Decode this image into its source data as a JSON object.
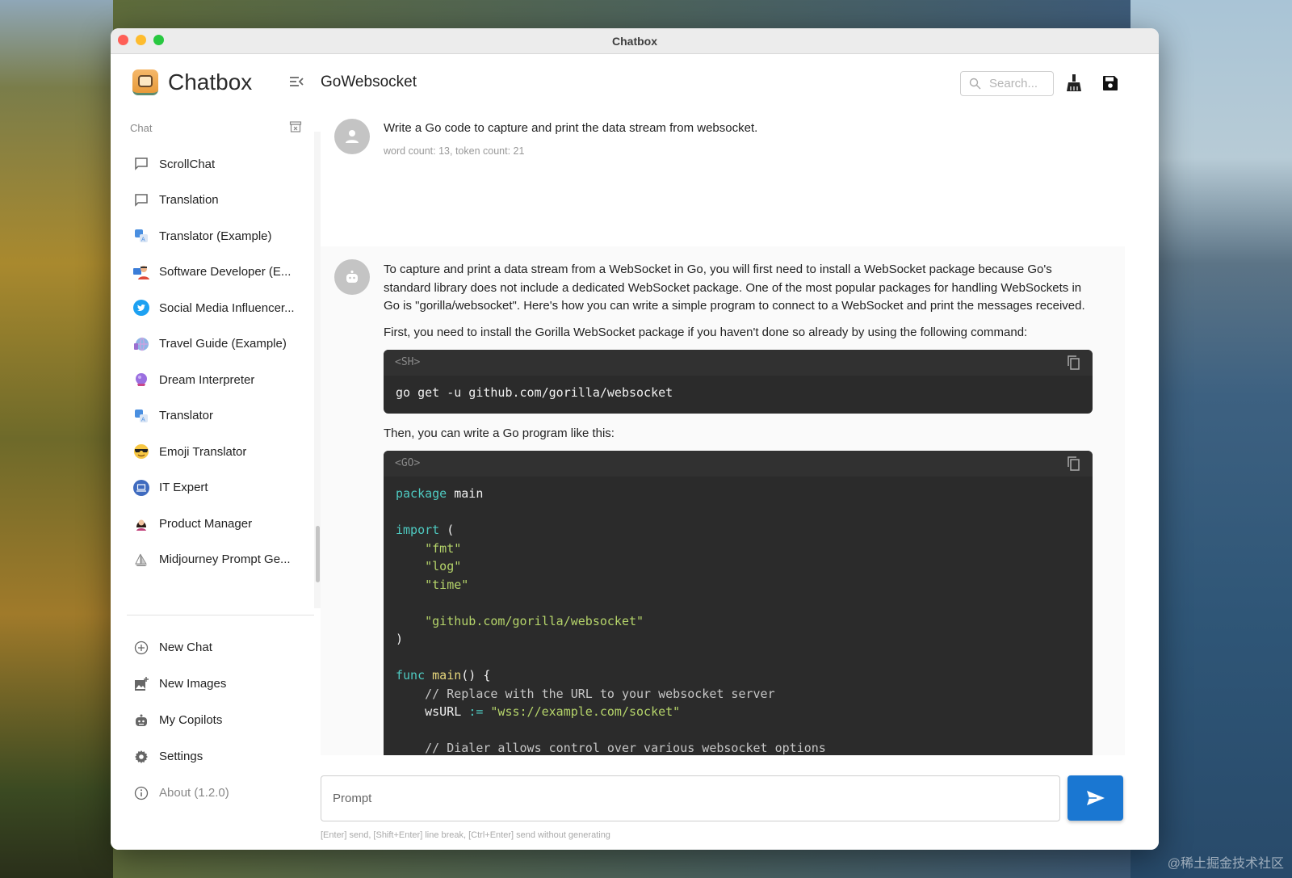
{
  "window": {
    "title": "Chatbox"
  },
  "watermark": "@稀土掘金技术社区",
  "sidebar": {
    "brand": "Chatbox",
    "section_label": "Chat",
    "chats": [
      {
        "label": "ScrollChat",
        "icon": "chat-bubble-icon"
      },
      {
        "label": "Translation",
        "icon": "chat-bubble-icon"
      },
      {
        "label": "Translator (Example)",
        "icon": "translate-avatar-icon"
      },
      {
        "label": "Software Developer (E...",
        "icon": "developer-avatar-icon"
      },
      {
        "label": "Social Media Influencer...",
        "icon": "twitter-avatar-icon"
      },
      {
        "label": "Travel Guide (Example)",
        "icon": "globe-avatar-icon"
      },
      {
        "label": "Dream Interpreter",
        "icon": "crystal-ball-avatar-icon"
      },
      {
        "label": "Translator",
        "icon": "translate-avatar-icon"
      },
      {
        "label": "Emoji Translator",
        "icon": "sunglasses-emoji-icon"
      },
      {
        "label": "IT Expert",
        "icon": "computer-avatar-icon"
      },
      {
        "label": "Product Manager",
        "icon": "woman-avatar-icon"
      },
      {
        "label": "Midjourney Prompt Ge...",
        "icon": "sailboat-avatar-icon"
      }
    ],
    "menu": [
      {
        "label": "New Chat",
        "icon": "plus-circle-icon"
      },
      {
        "label": "New Images",
        "icon": "add-image-icon"
      },
      {
        "label": "My Copilots",
        "icon": "robot-icon"
      },
      {
        "label": "Settings",
        "icon": "gear-icon"
      },
      {
        "label": "About (1.2.0)",
        "icon": "info-icon"
      }
    ]
  },
  "header": {
    "session_title": "GoWebsocket",
    "search_placeholder": "Search..."
  },
  "messages": {
    "user": {
      "text": "Write a Go code to capture and print the data stream from websocket.",
      "stats": "word count: 13, token count: 21"
    },
    "assistant": {
      "para1": "To capture and print a data stream from a WebSocket in Go, you will first need to install a WebSocket package because Go's standard library does not include a dedicated WebSocket package. One of the most popular packages for handling WebSockets in Go is \"gorilla/websocket\". Here's how you can write a simple program to connect to a WebSocket and print the messages received.",
      "para2": "First, you need to install the Gorilla WebSocket package if you haven't done so already by using the following command:",
      "code1_lang": "<SH>",
      "code1": "go get -u github.com/gorilla/websocket",
      "para3": "Then, you can write a Go program like this:",
      "code2_lang": "<GO>",
      "code2_lines": [
        [
          [
            "kw",
            "package"
          ],
          [
            "pl",
            " main"
          ]
        ],
        [],
        [
          [
            "kw",
            "import"
          ],
          [
            "pl",
            " ("
          ]
        ],
        [
          [
            "pl",
            "    "
          ],
          [
            "str",
            "\"fmt\""
          ]
        ],
        [
          [
            "pl",
            "    "
          ],
          [
            "str",
            "\"log\""
          ]
        ],
        [
          [
            "pl",
            "    "
          ],
          [
            "str",
            "\"time\""
          ]
        ],
        [],
        [
          [
            "pl",
            "    "
          ],
          [
            "str",
            "\"github.com/gorilla/websocket\""
          ]
        ],
        [
          [
            "pl",
            ")"
          ]
        ],
        [],
        [
          [
            "kw",
            "func"
          ],
          [
            "pl",
            " "
          ],
          [
            "fn",
            "main"
          ],
          [
            "pl",
            "() {"
          ]
        ],
        [
          [
            "pl",
            "    "
          ],
          [
            "cm",
            "// Replace with the URL to your websocket server"
          ]
        ],
        [
          [
            "pl",
            "    wsURL "
          ],
          [
            "op",
            ":="
          ],
          [
            "pl",
            " "
          ],
          [
            "str",
            "\"wss://example.com/socket\""
          ]
        ],
        [],
        [
          [
            "pl",
            "    "
          ],
          [
            "cm",
            "// Dialer allows control over various websocket options"
          ]
        ]
      ]
    }
  },
  "composer": {
    "placeholder": "Prompt",
    "hint": "[Enter] send, [Shift+Enter] line break, [Ctrl+Enter] send without generating"
  },
  "colors": {
    "accent": "#1a77d2",
    "code_bg": "#2b2b2b",
    "keyword": "#4ec9c0",
    "string": "#b5d46a"
  }
}
